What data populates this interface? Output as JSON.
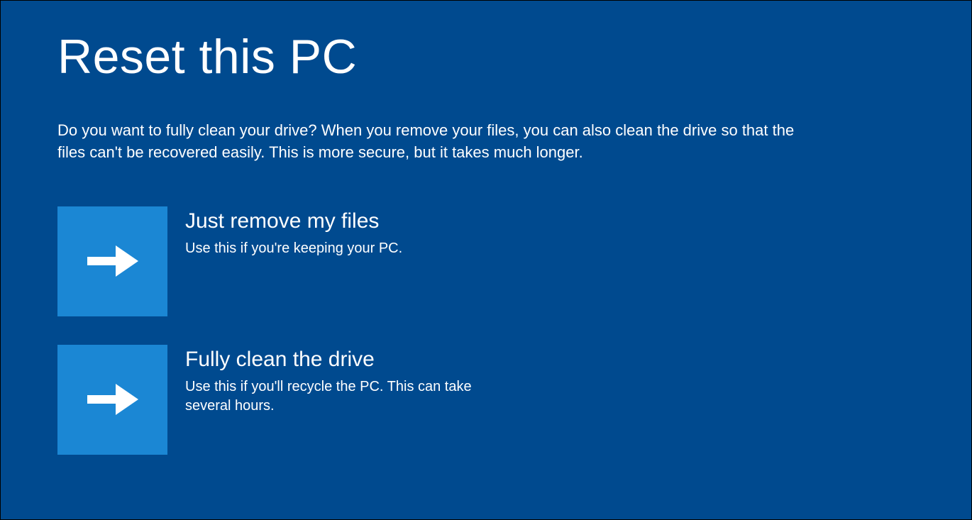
{
  "page": {
    "title": "Reset this PC",
    "description": "Do you want to fully clean your drive? When you remove your files, you can also clean the drive so that the files can't be recovered easily. This is more secure, but it takes much longer."
  },
  "options": [
    {
      "title": "Just remove my files",
      "description": "Use this if you're keeping your PC."
    },
    {
      "title": "Fully clean the drive",
      "description": "Use this if you'll recycle the PC. This can take several hours."
    }
  ],
  "colors": {
    "background": "#004a8f",
    "tile": "#1b87d4",
    "text": "#ffffff"
  }
}
